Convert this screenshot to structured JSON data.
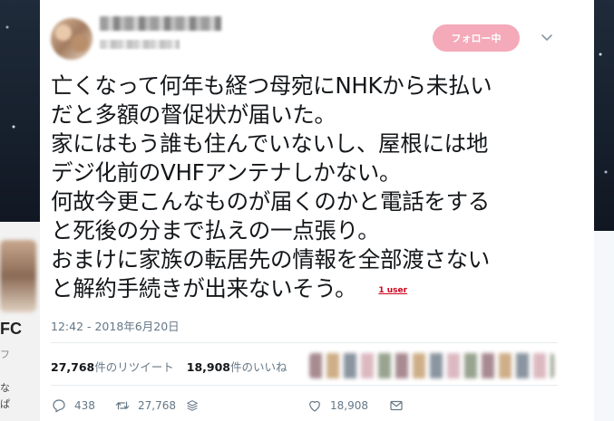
{
  "background": {
    "left_heading": "FC",
    "left_small_1": "フ",
    "left_small_2": "な",
    "left_small_3": "ぱ"
  },
  "tweet": {
    "follow_button": "フォロー中",
    "text_lines": [
      "亡くなって何年も経つ母宛にNHKから未払い",
      "だと多額の督促状が届いた。",
      "家にはもう誰も住んでいないし、屋根には地",
      "デジ化前のVHFアンテナしかない。",
      "何故今更こんなものが届くのかと電話をする",
      "と死後の分まで払えの一点張り。",
      "おまけに家族の転居先の情報を全部渡さない",
      "と解約手続きが出来ないそう。"
    ],
    "user_tag": "1 user",
    "timestamp": "12:42 - 2018年6月20日",
    "retweet_count": "27,768",
    "retweet_label": "件のリツイート",
    "like_count": "18,908",
    "like_label": "件のいいね",
    "actions": {
      "reply_count": "438",
      "retweet_count": "27,768",
      "like_count": "18,908"
    }
  },
  "colors": {
    "follow_button_bg": "#f4aab9",
    "text": "#14171a",
    "muted": "#657786",
    "user_tag": "#d0021b"
  }
}
